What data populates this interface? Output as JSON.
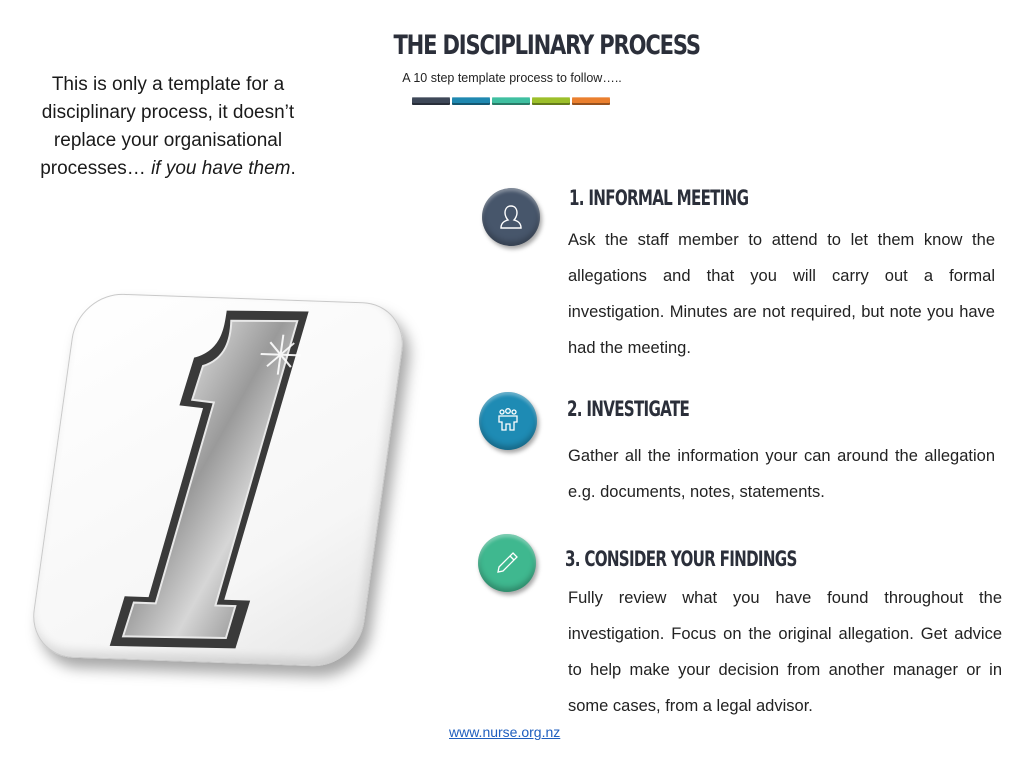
{
  "header": {
    "title": "THE DISCIPLINARY PROCESS",
    "subtitle": "A 10 step template process to follow…..",
    "color_bar": [
      "#3e4858",
      "#1f88b0",
      "#3fbfa0",
      "#9cbf2a",
      "#ea7f2e"
    ]
  },
  "disclaimer": {
    "text": "This is only a template for a disciplinary  process, it doesn’t replace your organisational processes… ",
    "emphasis": "if you have them",
    "end": "."
  },
  "badge": {
    "number": "1",
    "icon": "number-one-badge-icon"
  },
  "steps": [
    {
      "title": "1. INFORMAL MEETING",
      "icon": "person-icon",
      "color": "#47566b",
      "body": "Ask the staff member to attend to let them know the allegations and that you will carry out a formal investigation. Minutes are not required, but note you have had the meeting."
    },
    {
      "title": "2. INVESTIGATE",
      "icon": "group-icon",
      "color": "#1e8bb4",
      "body": "Gather all the information your can around the allegation e.g. documents, notes, statements."
    },
    {
      "title": "3. CONSIDER YOUR FINDINGS",
      "icon": "pencil-icon",
      "color": "#3fb88f",
      "body": "Fully review what you have found throughout the investigation. Focus on the original allegation. Get advice to help make your decision from another manager or in some cases, from a legal advisor."
    }
  ],
  "footer": {
    "link": "www.nurse.org.nz"
  }
}
